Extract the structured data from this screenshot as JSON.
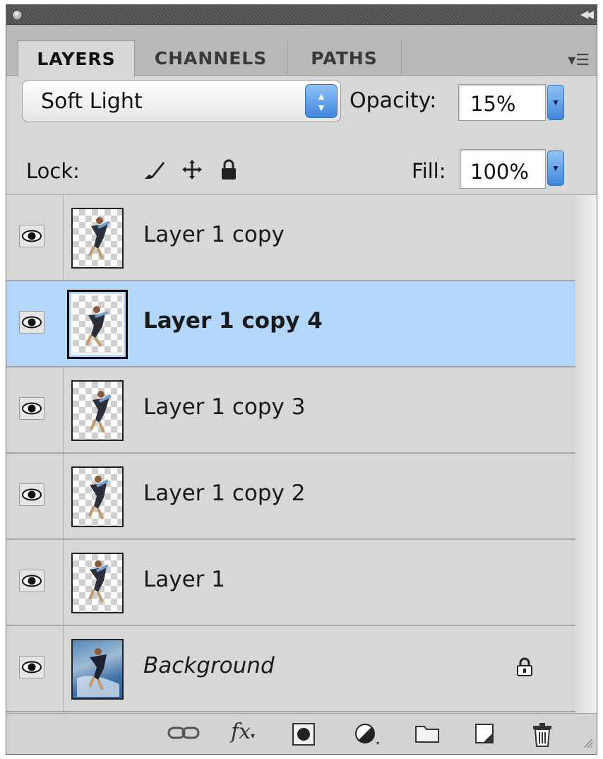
{
  "tabs": [
    {
      "label": "LAYERS",
      "active": true
    },
    {
      "label": "CHANNELS",
      "active": false
    },
    {
      "label": "PATHS",
      "active": false
    }
  ],
  "blend_mode": {
    "value": "Soft Light"
  },
  "opacity": {
    "label": "Opacity:",
    "value": "15%"
  },
  "lock": {
    "label": "Lock:"
  },
  "fill": {
    "label": "Fill:",
    "value": "100%"
  },
  "layers": [
    {
      "name": "Layer 1 copy",
      "visible": true,
      "selected": false
    },
    {
      "name": "Layer 1 copy 4",
      "visible": true,
      "selected": true
    },
    {
      "name": "Layer 1 copy 3",
      "visible": true,
      "selected": false
    },
    {
      "name": "Layer 1 copy 2",
      "visible": true,
      "selected": false
    },
    {
      "name": "Layer 1",
      "visible": true,
      "selected": false
    },
    {
      "name": "Background",
      "visible": true,
      "selected": false,
      "locked": true
    }
  ],
  "footer_icons": [
    "link-layers-icon",
    "fx-icon",
    "add-mask-icon",
    "adjustment-layer-icon",
    "new-group-icon",
    "new-layer-icon",
    "delete-layer-icon"
  ],
  "colors": {
    "selection": "#b3d6fb",
    "panel": "#d7d7d7",
    "accent": "#3f86dc"
  }
}
